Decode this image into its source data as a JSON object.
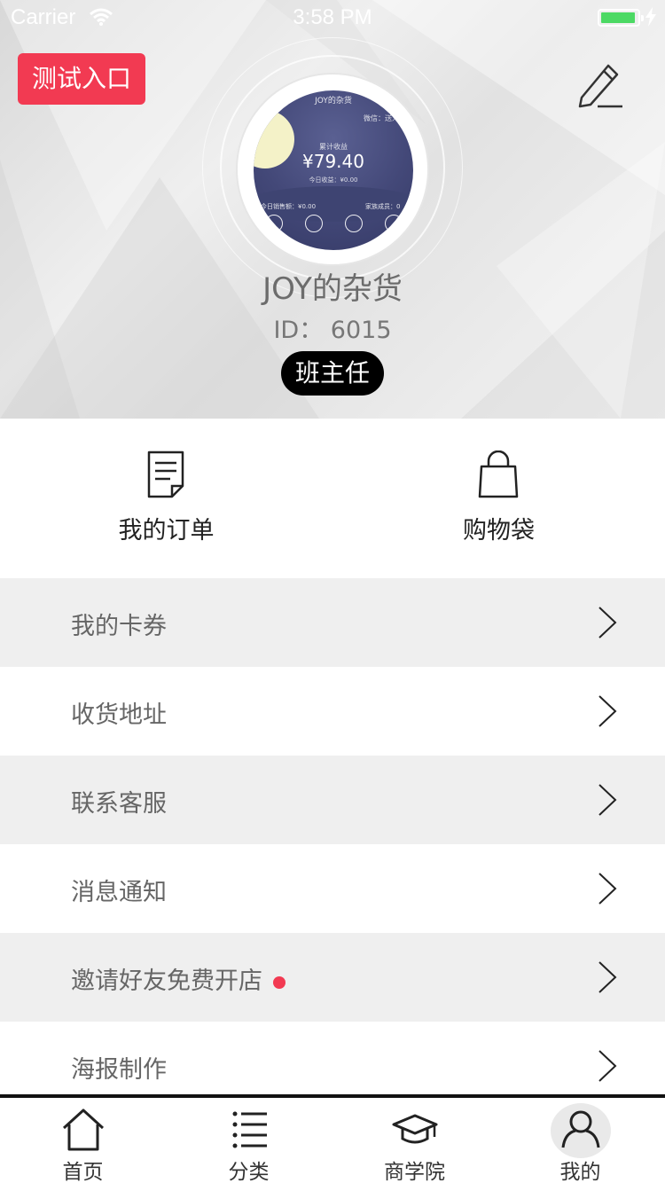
{
  "status_bar": {
    "carrier": "Carrier",
    "time": "3:58 PM",
    "battery_color": "#4cd964",
    "icons": [
      "wifi-icon",
      "battery-icon",
      "charging-icon"
    ]
  },
  "header": {
    "test_button_label": "测试入口",
    "edit_icon": "edit-icon",
    "user_name": "JOY的杂货",
    "user_id": "ID： 6015",
    "role": "班主任",
    "avatar": {
      "title": "JOY的杂货",
      "subtitle": "微信：送人",
      "label": "累计收益",
      "amount": "¥79.40",
      "today": "今日收益：¥0.00",
      "row_left": "今日销售额：¥0.00",
      "row_right": "家族成员：0"
    }
  },
  "quick_actions": [
    {
      "label": "我的订单",
      "icon": "order-document-icon"
    },
    {
      "label": "购物袋",
      "icon": "shopping-bag-icon"
    }
  ],
  "menu": [
    {
      "label": "我的卡券",
      "badge": false
    },
    {
      "label": "收货地址",
      "badge": false
    },
    {
      "label": "联系客服",
      "badge": false
    },
    {
      "label": "消息通知",
      "badge": false
    },
    {
      "label": "邀请好友免费开店",
      "badge": true
    },
    {
      "label": "海报制作",
      "badge": false
    }
  ],
  "tabbar": [
    {
      "label": "首页",
      "icon": "home-icon",
      "active": false
    },
    {
      "label": "分类",
      "icon": "list-icon",
      "active": false
    },
    {
      "label": "商学院",
      "icon": "graduation-cap-icon",
      "active": false
    },
    {
      "label": "我的",
      "icon": "user-icon",
      "active": true
    }
  ],
  "colors": {
    "accent": "#f23a52",
    "badge_bg": "#000000",
    "menu_gray": "#efefef"
  }
}
